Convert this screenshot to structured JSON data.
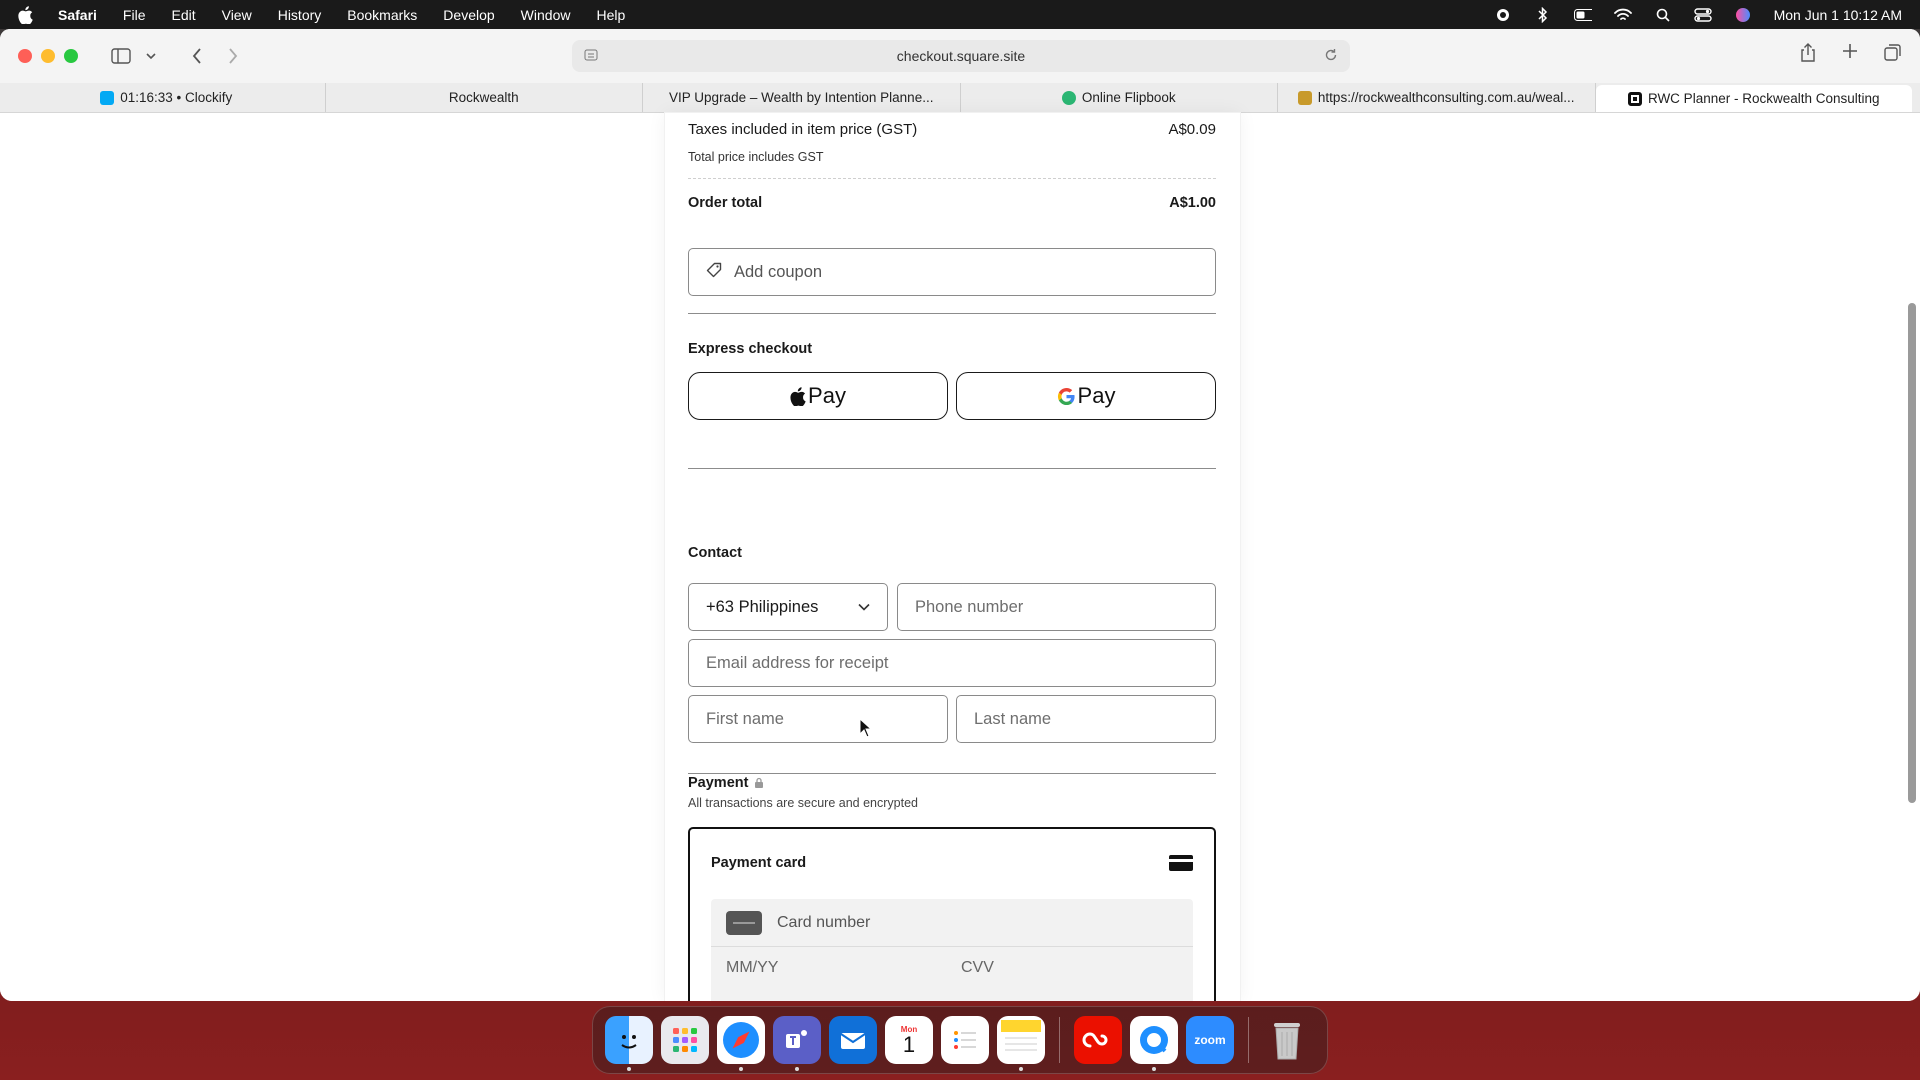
{
  "menubar": {
    "app": "Safari",
    "items": [
      "File",
      "Edit",
      "View",
      "History",
      "Bookmarks",
      "Develop",
      "Window",
      "Help"
    ],
    "clock": "Mon Jun 1  10:12 AM"
  },
  "browser": {
    "url": "checkout.square.site",
    "tabs": [
      {
        "label": "01:16:33 • Clockify",
        "favicon_color": "#03a9f4"
      },
      {
        "label": "Rockwealth",
        "favicon_color": ""
      },
      {
        "label": "VIP Upgrade – Wealth by Intention Planne...",
        "favicon_color": ""
      },
      {
        "label": "Online Flipbook",
        "favicon_color": "#2bb673"
      },
      {
        "label": "https://rockwealthconsulting.com.au/weal...",
        "favicon_color": "#c89a2b"
      },
      {
        "label": "RWC Planner - Rockwealth Consulting",
        "favicon_color": "#111111"
      }
    ]
  },
  "order": {
    "tax_label": "Taxes included in item price (GST)",
    "tax_value": "A$0.09",
    "tax_note": "Total price includes GST",
    "total_label": "Order total",
    "total_value": "A$1.00",
    "coupon_placeholder": "Add coupon"
  },
  "express": {
    "title": "Express checkout",
    "apple_pay": "Pay",
    "google_pay": "Pay"
  },
  "contact": {
    "title": "Contact",
    "country_code": "+63 Philippines",
    "phone_placeholder": "Phone number",
    "email_placeholder": "Email address for receipt",
    "first_placeholder": "First name",
    "last_placeholder": "Last name"
  },
  "payment": {
    "title": "Payment",
    "subtitle": "All transactions are secure and encrypted",
    "card_title": "Payment card",
    "card_number_placeholder": "Card number",
    "expiry_placeholder": "MM/YY",
    "cvv_placeholder": "CVV"
  },
  "dock": {
    "zoom_label": "zoom",
    "calendar_month": "Mon",
    "calendar_day": "1"
  },
  "colors": {
    "accent_dark": "#1a1a1a",
    "border": "#8a8a8a"
  }
}
